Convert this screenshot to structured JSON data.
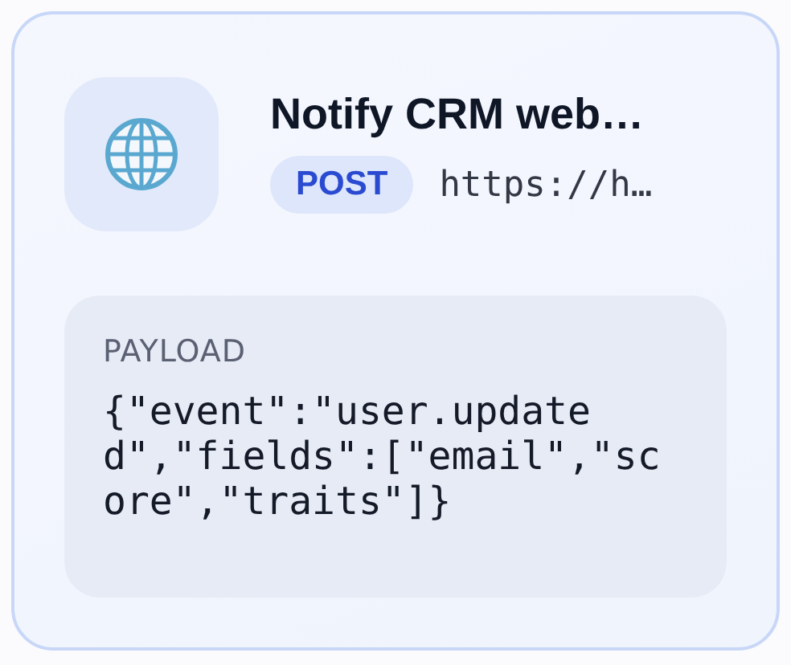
{
  "card": {
    "title": "Notify CRM web…",
    "method": "POST",
    "url": "https://h…",
    "payload": {
      "label": "PAYLOAD",
      "body": "{\"event\":\"user.updated\",\"fields\":[\"email\",\"score\",\"traits\"]}"
    }
  }
}
